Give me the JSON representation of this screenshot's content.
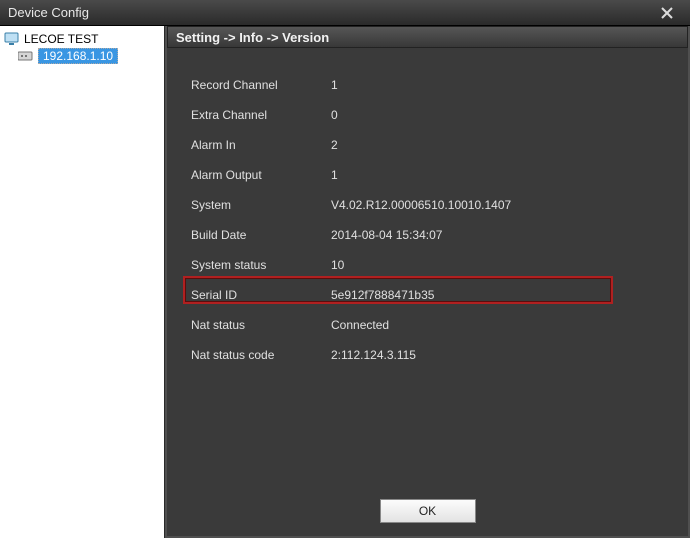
{
  "window": {
    "title": "Device Config"
  },
  "tree": {
    "root_label": "LECOE TEST",
    "child_label": "192.168.1.10"
  },
  "section": {
    "breadcrumb": "Setting -> Info -> Version"
  },
  "info": {
    "record_channel_label": "Record Channel",
    "record_channel_value": "1",
    "extra_channel_label": "Extra Channel",
    "extra_channel_value": "0",
    "alarm_in_label": "Alarm In",
    "alarm_in_value": "2",
    "alarm_output_label": "Alarm Output",
    "alarm_output_value": "1",
    "system_label": "System",
    "system_value": "V4.02.R12.00006510.10010.1407",
    "build_date_label": "Build Date",
    "build_date_value": "2014-08-04 15:34:07",
    "system_status_label": "System status",
    "system_status_value": "10",
    "serial_id_label": "Serial ID",
    "serial_id_value": "5e912f7888471b35",
    "nat_status_label": "Nat status",
    "nat_status_value": "Connected",
    "nat_code_label": "Nat status code",
    "nat_code_value": "2:112.124.3.115"
  },
  "buttons": {
    "ok": "OK"
  }
}
